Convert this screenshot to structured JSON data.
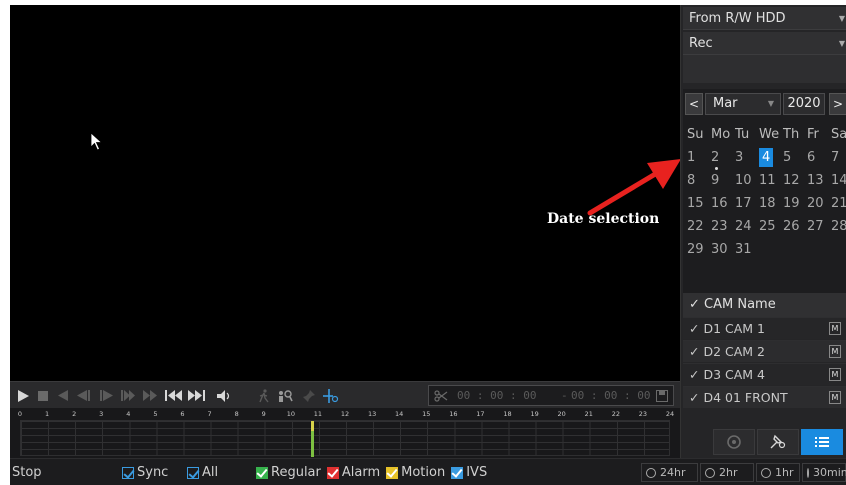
{
  "source_dropdown": {
    "value": "From R/W HDD"
  },
  "type_dropdown": {
    "value": "Rec"
  },
  "calendar": {
    "prev": "<",
    "next": ">",
    "month": "Mar",
    "year": "2020",
    "weekdays": [
      "Su",
      "Mo",
      "Tu",
      "We",
      "Th",
      "Fr",
      "Sa"
    ],
    "weeks": [
      [
        "1",
        "2",
        "3",
        "4",
        "5",
        "6",
        "7"
      ],
      [
        "8",
        "9",
        "10",
        "11",
        "12",
        "13",
        "14"
      ],
      [
        "15",
        "16",
        "17",
        "18",
        "19",
        "20",
        "21"
      ],
      [
        "22",
        "23",
        "24",
        "25",
        "26",
        "27",
        "28"
      ],
      [
        "29",
        "30",
        "31",
        "",
        "",
        "",
        ""
      ]
    ],
    "selected_day": "4",
    "recorded_day": "2"
  },
  "annotation": {
    "label": "Date selection",
    "color": "#e8221f"
  },
  "camera_list": {
    "header": "✓ CAM Name",
    "cameras": [
      {
        "label": "✓ D1 CAM 1",
        "mode": "M"
      },
      {
        "label": "✓ D2 CAM 2",
        "mode": "M"
      },
      {
        "label": "✓ D3 CAM 4",
        "mode": "M"
      },
      {
        "label": "✓ D4 01 FRONT",
        "mode": "M"
      }
    ]
  },
  "clip": {
    "start_time": "00 : 00 : 00",
    "separator": "-",
    "end_time": "00 : 00 : 00"
  },
  "timeline": {
    "hours": [
      "0",
      "1",
      "2",
      "3",
      "4",
      "5",
      "6",
      "7",
      "8",
      "9",
      "10",
      "11",
      "12",
      "13",
      "14",
      "15",
      "16",
      "17",
      "18",
      "19",
      "20",
      "21",
      "22",
      "23",
      "24"
    ],
    "recording_hour": 10.7,
    "record_color": "#7dc041"
  },
  "status_bar": {
    "state": "Stop",
    "sync_label": "Sync",
    "all_label": "All",
    "legend": [
      {
        "label": "Regular",
        "color": "#37b24d"
      },
      {
        "label": "Alarm",
        "color": "#e03131"
      },
      {
        "label": "Motion",
        "color": "#e6c229"
      },
      {
        "label": "IVS",
        "color": "#3a9be0"
      }
    ],
    "time_ranges": [
      "24hr",
      "2hr",
      "1hr",
      "30min"
    ]
  },
  "accent_color": "#1a8be0"
}
